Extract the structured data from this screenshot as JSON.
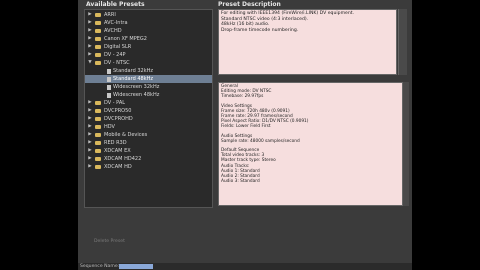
{
  "panels": {
    "presets_label": "Available Presets",
    "description_label": "Preset Description"
  },
  "tree": [
    {
      "label": "ARRI",
      "expanded": false,
      "kind": "folder",
      "level": 0
    },
    {
      "label": "AVC-Intra",
      "expanded": false,
      "kind": "folder",
      "level": 0
    },
    {
      "label": "AVCHD",
      "expanded": false,
      "kind": "folder",
      "level": 0
    },
    {
      "label": "Canon XF MPEG2",
      "expanded": false,
      "kind": "folder",
      "level": 0
    },
    {
      "label": "Digital SLR",
      "expanded": false,
      "kind": "folder",
      "level": 0
    },
    {
      "label": "DV - 24P",
      "expanded": false,
      "kind": "folder",
      "level": 0
    },
    {
      "label": "DV - NTSC",
      "expanded": true,
      "kind": "folder",
      "level": 0
    },
    {
      "label": "Standard 32kHz",
      "kind": "preset",
      "level": 1
    },
    {
      "label": "Standard 48kHz",
      "kind": "preset",
      "level": 1,
      "selected": true
    },
    {
      "label": "Widescreen 32kHz",
      "kind": "preset",
      "level": 1
    },
    {
      "label": "Widescreen 48kHz",
      "kind": "preset",
      "level": 1
    },
    {
      "label": "DV - PAL",
      "expanded": false,
      "kind": "folder",
      "level": 0
    },
    {
      "label": "DVCPRO50",
      "expanded": false,
      "kind": "folder",
      "level": 0
    },
    {
      "label": "DVCPROHD",
      "expanded": false,
      "kind": "folder",
      "level": 0
    },
    {
      "label": "HDV",
      "expanded": false,
      "kind": "folder",
      "level": 0
    },
    {
      "label": "Mobile & Devices",
      "expanded": false,
      "kind": "folder",
      "level": 0
    },
    {
      "label": "RED R3D",
      "expanded": false,
      "kind": "folder",
      "level": 0
    },
    {
      "label": "XDCAM EX",
      "expanded": false,
      "kind": "folder",
      "level": 0
    },
    {
      "label": "XDCAM HD422",
      "expanded": false,
      "kind": "folder",
      "level": 0
    },
    {
      "label": "XDCAM HD",
      "expanded": false,
      "kind": "folder",
      "level": 0
    }
  ],
  "description_top": [
    "For editing with IEEE1394 (FireWire/i.LINK) DV equipment.",
    "Standard NTSC video (4:3 interlaced).",
    "48kHz (16 bit) audio.",
    "Drop-frame timecode numbering."
  ],
  "description_bottom": [
    "General",
    "Editing mode: DV NTSC",
    "Timebase: 29.97fps",
    "",
    "Video Settings",
    "Frame size: 720h 480v (0.9091)",
    "Frame rate: 29.97 frames/second",
    "Pixel Aspect Ratio: D1/DV NTSC (0.9091)",
    "Fields: Lower Field First",
    "",
    "Audio Settings",
    "Sample rate: 48000 samples/second",
    "",
    "Default Sequence",
    "Total video tracks: 3",
    "Master track type: Stereo",
    "Audio Tracks:",
    "Audio 1: Standard",
    "Audio 2: Standard",
    "Audio 3: Standard"
  ],
  "buttons": {
    "delete_preset": "Delete Preset"
  },
  "sequence_name_label": "Sequence Name:"
}
